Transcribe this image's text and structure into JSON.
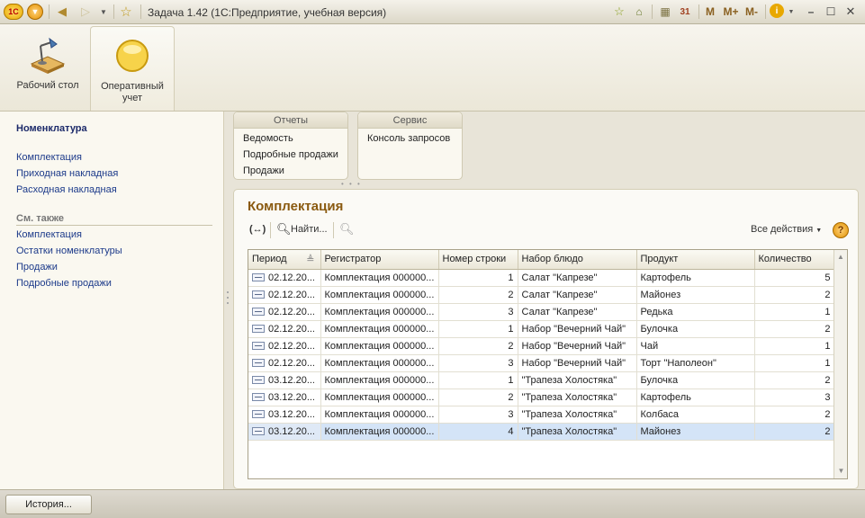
{
  "window": {
    "title": "Задача 1.42  (1С:Предприятие, учебная версия)",
    "logo_text": "1С",
    "memory_buttons": [
      "M",
      "M+",
      "M-"
    ]
  },
  "sections": [
    {
      "label": "Рабочий стол"
    },
    {
      "label": "Оперативный учет"
    }
  ],
  "nav": {
    "header": "Номенклатура",
    "items": [
      "Комплектация",
      "Приходная накладная",
      "Расходная накладная"
    ],
    "see_also_label": "См. также",
    "see_also": [
      "Комплектация",
      "Остатки номенклатуры",
      "Продажи",
      "Подробные продажи"
    ]
  },
  "command_groups": [
    {
      "title": "Отчеты",
      "items": [
        "Ведомость",
        "Подробные продажи",
        "Продажи"
      ]
    },
    {
      "title": "Сервис",
      "items": [
        "Консоль запросов"
      ]
    }
  ],
  "work": {
    "title": "Комплектация",
    "find_label": "Найти...",
    "all_actions_label": "Все действия",
    "help": "?"
  },
  "table": {
    "columns": [
      "Период",
      "Регистратор",
      "Номер строки",
      "Набор блюдо",
      "Продукт",
      "Количество"
    ],
    "rows": [
      [
        "02.12.20...",
        "Комплектация 000000...",
        "1",
        "Салат \"Капрезе\"",
        "Картофель",
        "5"
      ],
      [
        "02.12.20...",
        "Комплектация 000000...",
        "2",
        "Салат \"Капрезе\"",
        "Майонез",
        "2"
      ],
      [
        "02.12.20...",
        "Комплектация 000000...",
        "3",
        "Салат \"Капрезе\"",
        "Редька",
        "1"
      ],
      [
        "02.12.20...",
        "Комплектация 000000...",
        "1",
        "Набор \"Вечерний Чай\"",
        "Булочка",
        "2"
      ],
      [
        "02.12.20...",
        "Комплектация 000000...",
        "2",
        "Набор \"Вечерний Чай\"",
        "Чай",
        "1"
      ],
      [
        "02.12.20...",
        "Комплектация 000000...",
        "3",
        "Набор \"Вечерний Чай\"",
        "Торт \"Наполеон\"",
        "1"
      ],
      [
        "03.12.20...",
        "Комплектация 000000...",
        "1",
        "\"Трапеза Холостяка\"",
        "Булочка",
        "2"
      ],
      [
        "03.12.20...",
        "Комплектация 000000...",
        "2",
        "\"Трапеза Холостяка\"",
        "Картофель",
        "3"
      ],
      [
        "03.12.20...",
        "Комплектация 000000...",
        "3",
        "\"Трапеза Холостяка\"",
        "Колбаса",
        "2"
      ],
      [
        "03.12.20...",
        "Комплектация 000000...",
        "4",
        "\"Трапеза Холостяка\"",
        "Майонез",
        "2"
      ]
    ],
    "selected_row_index": 9
  },
  "status": {
    "history_label": "История..."
  }
}
